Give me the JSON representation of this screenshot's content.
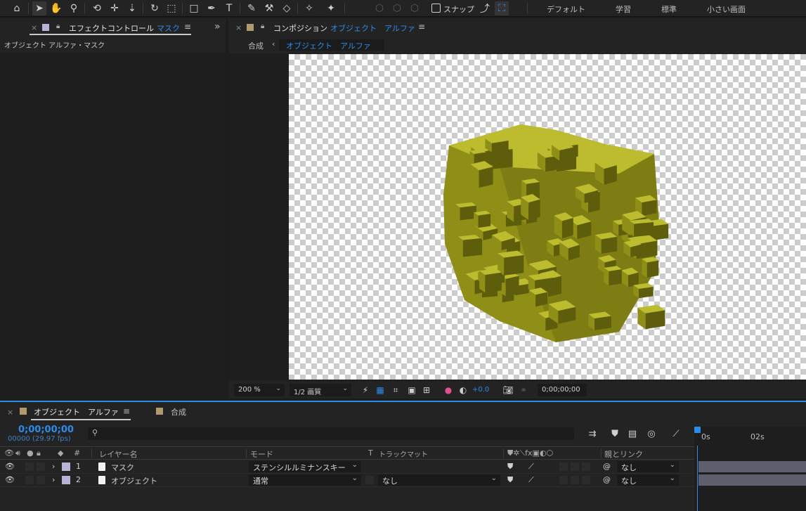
{
  "workspaces": [
    "デフォルト",
    "学習",
    "標準",
    "小さい画面"
  ],
  "toolbar": {
    "snap_label": "スナップ"
  },
  "effect_panel": {
    "tab_prefix": "エフェクトコントロール",
    "tab_layer": "マスク",
    "subtitle": "オブジェクト アルファ・マスク",
    "swatch_color": "#b5b3d6"
  },
  "comp_panel": {
    "tab_prefix": "コンポジション",
    "tab_comp": "オブジェクト　アルファ",
    "nav_parent": "合成",
    "nav_current": "オブジェクト　アルファ",
    "swatch_color": "#b09a6e"
  },
  "comp_footer": {
    "zoom": "200 %",
    "resolution": "1/2 画質",
    "exposure": "+0.0",
    "timecode": "0;00;00;00"
  },
  "timeline": {
    "tabs": [
      "オブジェクト　アルファ",
      "合成"
    ],
    "current_time": "0;00;00;00",
    "frame_info": "00000 (29.97 fps)",
    "headers": {
      "number": "#",
      "layer_name": "レイヤー名",
      "mode": "モード",
      "t": "T",
      "track_matte": "トラックマット",
      "parent": "親とリンク"
    },
    "layers": [
      {
        "num": "1",
        "name": "マスク",
        "mode": "ステンシルルミナンスキー",
        "matte": "",
        "parent": "なし"
      },
      {
        "num": "2",
        "name": "オブジェクト",
        "mode": "通常",
        "matte": "なし",
        "parent": "なし"
      }
    ],
    "ruler_labels": [
      "0s",
      "02s"
    ]
  },
  "colors": {
    "accent": "#2d8ceb",
    "cube_top": "#bcbc2e",
    "cube_side": "#8f8f18",
    "cube_shadow": "#5d5d0c"
  }
}
